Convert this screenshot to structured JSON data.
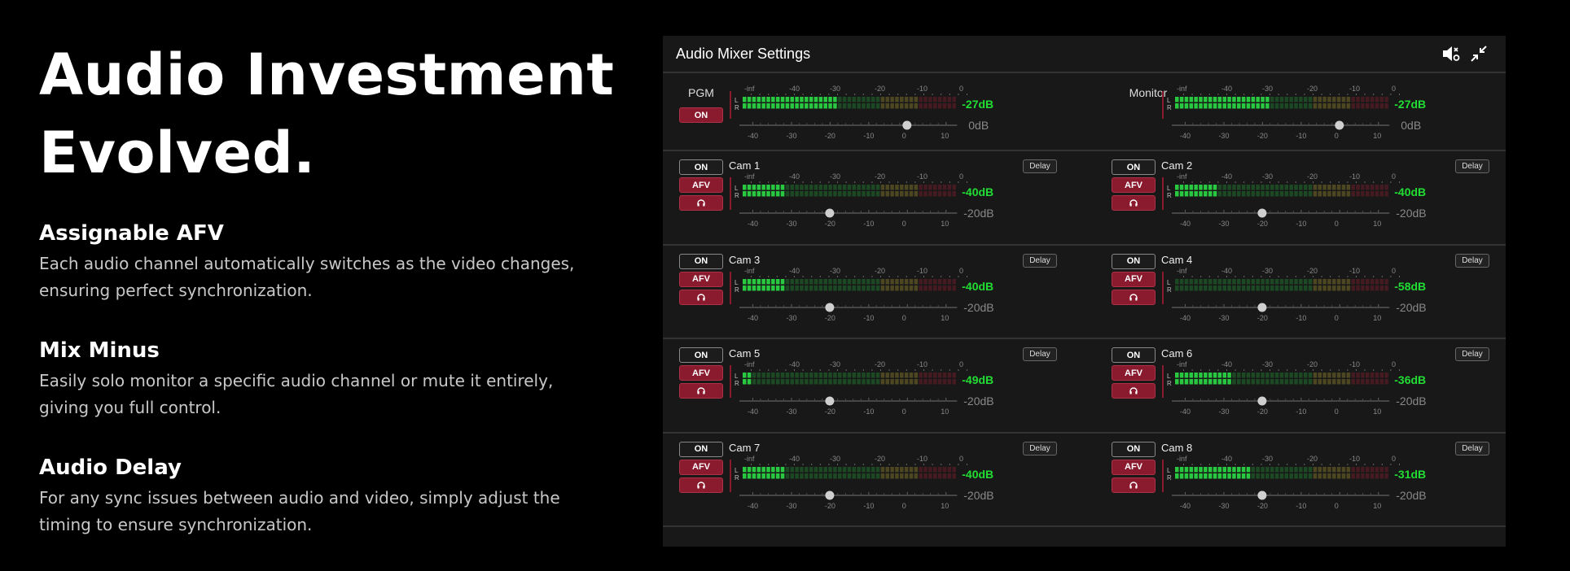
{
  "headline": {
    "line1": "Audio Investment",
    "line2": "Evolved."
  },
  "features": [
    {
      "title": "Assignable AFV",
      "desc_line1": "Each audio channel automatically switches as the video changes,",
      "desc_line2": "ensuring perfect synchronization."
    },
    {
      "title": "Mix Minus",
      "desc_line1": "Easily solo monitor a specific audio channel or mute it entirely,",
      "desc_line2": "giving you full control."
    },
    {
      "title": "Audio Delay",
      "desc_line1": "For any sync issues between audio and video, simply adjust the",
      "desc_line2": "timing to ensure synchronization."
    }
  ],
  "panel": {
    "title": "Audio Mixer Settings",
    "icons": {
      "mute": "speaker-settings-icon",
      "collapse": "collapse-icon"
    },
    "meter_scale_top": [
      "-inf",
      "-40",
      "-30",
      "-20",
      "-10",
      "0"
    ],
    "meter_scale_bottom": [
      "-40",
      "-30",
      "-20",
      "-10",
      "0",
      "10"
    ],
    "lr_labels": [
      "L",
      "R"
    ],
    "on_label": "ON",
    "afv_label": "AFV",
    "delay_label": "Delay",
    "colors": {
      "green": "#28c840",
      "yellow": "#b0a030",
      "red": "#9a2030",
      "accent": "#8a1a2e",
      "readout": "#22dd33"
    },
    "masters": [
      {
        "name": "PGM",
        "level_db": "-27dB",
        "fader_db": "0dB",
        "fader_value": 0,
        "meter_level": 20,
        "has_on": true
      },
      {
        "name": "Monitor",
        "level_db": "-27dB",
        "fader_db": "0dB",
        "fader_value": 0,
        "meter_level": 20,
        "has_on": false
      }
    ],
    "channels": [
      {
        "name": "Cam 1",
        "level_db": "-40dB",
        "fader_db": "-20dB",
        "fader_value": -20,
        "meter_level": 9
      },
      {
        "name": "Cam 2",
        "level_db": "-40dB",
        "fader_db": "-20dB",
        "fader_value": -20,
        "meter_level": 9
      },
      {
        "name": "Cam 3",
        "level_db": "-40dB",
        "fader_db": "-20dB",
        "fader_value": -20,
        "meter_level": 9
      },
      {
        "name": "Cam 4",
        "level_db": "-58dB",
        "fader_db": "-20dB",
        "fader_value": -20,
        "meter_level": 0
      },
      {
        "name": "Cam 5",
        "level_db": "-49dB",
        "fader_db": "-20dB",
        "fader_value": -20,
        "meter_level": 2
      },
      {
        "name": "Cam 6",
        "level_db": "-36dB",
        "fader_db": "-20dB",
        "fader_value": -20,
        "meter_level": 12
      },
      {
        "name": "Cam 7",
        "level_db": "-40dB",
        "fader_db": "-20dB",
        "fader_value": -20,
        "meter_level": 9
      },
      {
        "name": "Cam 8",
        "level_db": "-31dB",
        "fader_db": "-20dB",
        "fader_value": -20,
        "meter_level": 16
      }
    ]
  }
}
